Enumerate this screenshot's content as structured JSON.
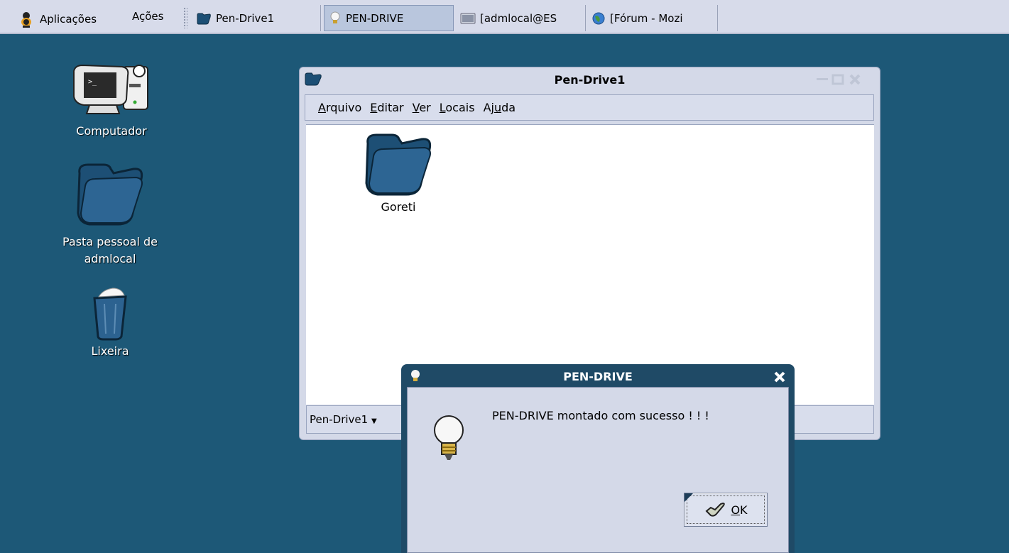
{
  "panel": {
    "applications": "Aplicações",
    "actions": "Ações",
    "tasks": [
      {
        "label": "Pen-Drive1",
        "icon": "folder-icon"
      },
      {
        "label": "PEN-DRIVE",
        "icon": "lightbulb-icon"
      },
      {
        "label": "[admlocal@ES",
        "icon": "terminal-icon"
      },
      {
        "label": "[Fórum - Mozi",
        "icon": "globe-icon"
      }
    ]
  },
  "desktop": {
    "computer": "Computador",
    "home_line1": "Pasta pessoal de",
    "home_line2": "admlocal",
    "trash": "Lixeira"
  },
  "file_manager": {
    "title": "Pen-Drive1",
    "menu": [
      "Arquivo",
      "Editar",
      "Ver",
      "Locais",
      "Ajuda"
    ],
    "items": [
      {
        "label": "Goreti",
        "icon": "folder-icon"
      }
    ],
    "location": "Pen-Drive1"
  },
  "dialog": {
    "title": "PEN-DRIVE",
    "message": "PEN-DRIVE montado com sucesso ! ! !",
    "ok_label": "OK"
  },
  "colors": {
    "desktop": "#1d5877",
    "panel": "#d7dbea",
    "folder": "#2a5d85",
    "dialog_frame": "#1f4a66"
  }
}
